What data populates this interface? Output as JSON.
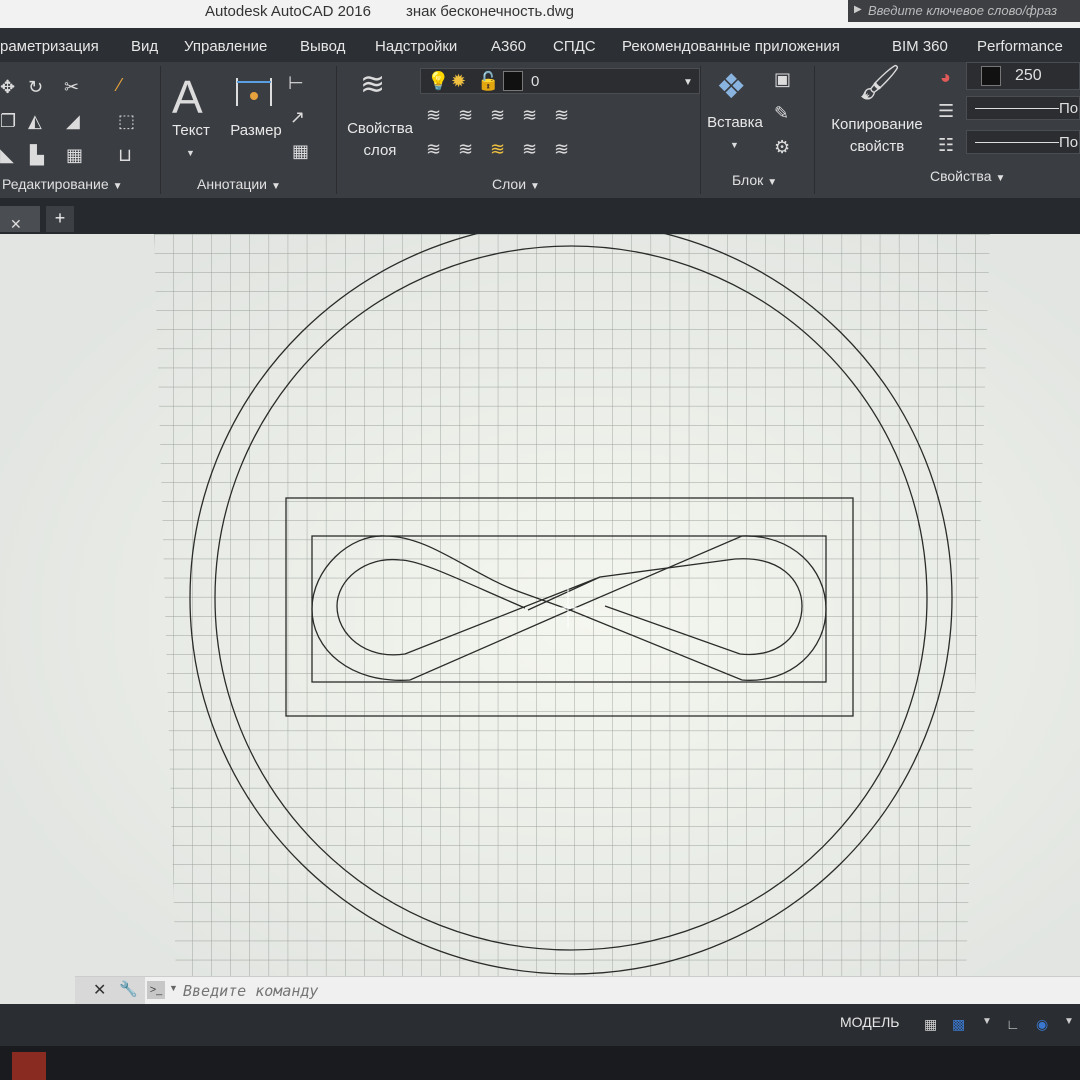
{
  "window": {
    "app_title": "Autodesk AutoCAD 2016",
    "file_name": "знак бесконечность.dwg",
    "search_placeholder": "Введите ключевое слово/фраз"
  },
  "ribbon_tabs": [
    "раметризация",
    "Вид",
    "Управление",
    "Вывод",
    "Надстройки",
    "А360",
    "СПДС",
    "Рекомендованные приложения",
    "BIM 360",
    "Performance"
  ],
  "ribbon": {
    "groups": {
      "edit": "Редактирование",
      "annotations": "Аннотации",
      "layers": "Слои",
      "block": "Блок",
      "properties": "Свойства"
    },
    "buttons": {
      "text": "Текст",
      "dimension": "Размер",
      "layer_props_line1": "Свойства",
      "layer_props_line2": "слоя",
      "insert": "Вставка",
      "match_props_line1": "Копирование",
      "match_props_line2": "свойств"
    },
    "layer_current": "0",
    "color_value": "250",
    "lineweight_label": "По",
    "linetype_label": "По"
  },
  "command_line": {
    "placeholder": "Введите команду"
  },
  "statusbar": {
    "model": "МОДЕЛЬ"
  },
  "colors": {
    "ribbon_bg": "#3a3d42",
    "tabs_bg": "#2c2f33",
    "canvas_bg": "#e4e6e3",
    "grid": "#9aa09a",
    "stroke": "#2a2c2a"
  }
}
